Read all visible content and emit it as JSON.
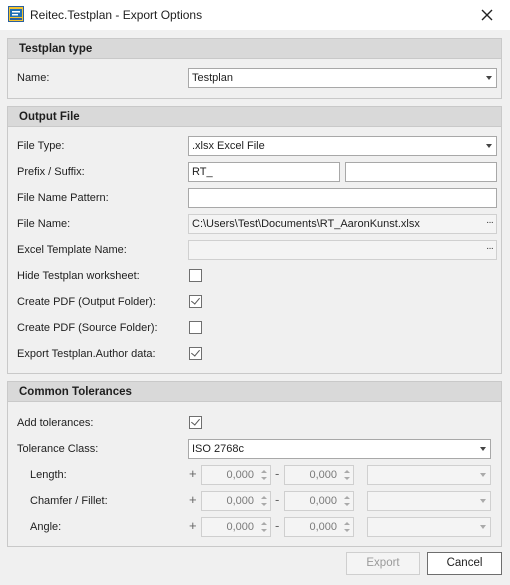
{
  "window": {
    "title": "Reitec.Testplan - Export Options"
  },
  "testplan_type": {
    "header": "Testplan type",
    "name_label": "Name:",
    "name_value": "Testplan"
  },
  "output_file": {
    "header": "Output File",
    "file_type_label": "File Type:",
    "file_type_value": ".xlsx Excel File",
    "prefix_suffix_label": "Prefix / Suffix:",
    "prefix_value": "RT_",
    "suffix_value": "",
    "file_name_pattern_label": "File Name Pattern:",
    "file_name_pattern_value": "",
    "file_name_label": "File Name:",
    "file_name_value": "C:\\Users\\Test\\Documents\\RT_AaronKunst.xlsx",
    "excel_template_label": "Excel Template Name:",
    "excel_template_value": "",
    "browse_label": "···",
    "hide_worksheet_label": "Hide Testplan worksheet:",
    "hide_worksheet_checked": false,
    "pdf_output_label": "Create PDF (Output Folder):",
    "pdf_output_checked": true,
    "pdf_source_label": "Create PDF (Source Folder):",
    "pdf_source_checked": false,
    "export_author_label": "Export Testplan.Author data:",
    "export_author_checked": true
  },
  "tolerances": {
    "header": "Common Tolerances",
    "add_label": "Add tolerances:",
    "add_checked": true,
    "class_label": "Tolerance Class:",
    "class_value": "ISO 2768c",
    "plus_sign": "+",
    "minus_sign": "-",
    "rows": [
      {
        "label": "Length:",
        "plus": "0,000",
        "minus": "0,000"
      },
      {
        "label": "Chamfer / Fillet:",
        "plus": "0,000",
        "minus": "0,000"
      },
      {
        "label": "Angle:",
        "plus": "0,000",
        "minus": "0,000"
      }
    ]
  },
  "footer": {
    "export_label": "Export",
    "cancel_label": "Cancel"
  }
}
